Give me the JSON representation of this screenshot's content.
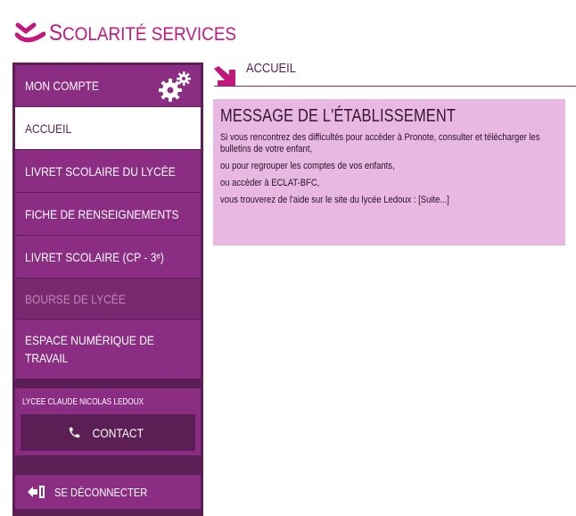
{
  "brand": {
    "first_letter": "S",
    "rest": "COLARITÉ SERVICES"
  },
  "sidebar": {
    "items": [
      {
        "label": "MON COMPTE"
      },
      {
        "label": "ACCUEIL"
      },
      {
        "label": "LIVRET SCOLAIRE DU LYCÉE"
      },
      {
        "label": "FICHE DE RENSEIGNEMENTS"
      },
      {
        "label": "LIVRET SCOLAIRE (CP - 3ᵉ)"
      },
      {
        "label": "BOURSE DE LYCÉE"
      },
      {
        "label": "ESPACE NUMÉRIQUE DE TRAVAIL"
      }
    ],
    "school_name": "LYCEE CLAUDE NICOLAS LEDOUX",
    "contact_label": "CONTACT",
    "logout_label": "SE DÉCONNECTER"
  },
  "main": {
    "header_title": "ACCUEIL",
    "message_title": "MESSAGE DE L'ÉTABLISSEMENT",
    "lines": [
      "Si vous rencontrez des difficultés pour accèder à Pronote, consulter et télécharger les bulletins de votre enfant,",
      "ou pour regrouper les comptes de vos enfants,",
      "ou accèder à ECLAT-BFC,",
      "vous trouverez de l'aide sur le site du lycée Ledoux : [Suite...]"
    ]
  },
  "colors": {
    "accent": "#c2187c",
    "purple": "#8c2d84",
    "dark_purple": "#5b1f55",
    "message_bg": "#e8b8e3"
  }
}
